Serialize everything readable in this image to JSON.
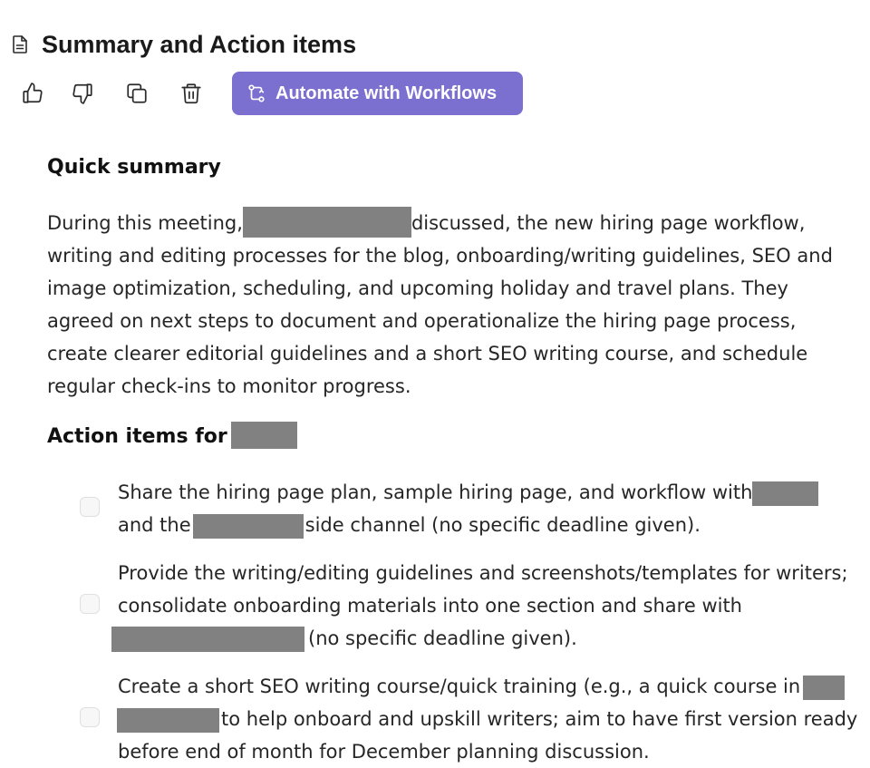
{
  "header": {
    "title": "Summary and Action items",
    "doc_icon": "document-icon"
  },
  "toolbar": {
    "like_icon": "thumbs-up-icon",
    "dislike_icon": "thumbs-down-icon",
    "copy_icon": "copy-icon",
    "delete_icon": "trash-icon",
    "workflow_label": "Automate with Workflows",
    "workflow_icon": "workflow-icon",
    "workflow_color": "#7b6fd0"
  },
  "summary": {
    "heading": "Quick summary",
    "text_before_redaction": "During this meeting,",
    "text_after_redaction": "discussed, the new hiring page workflow, writing and editing processes for the blog, onboarding/writing guidelines, SEO and image optimization, scheduling, and upcoming holiday and travel plans. They agreed on next steps to document and operationalize the hiring page process, create clearer editorial guidelines and a short SEO writing course, and schedule regular check-ins to monitor progress."
  },
  "action_items": {
    "heading": "Action items for",
    "items": [
      {
        "part1": "Share the hiring page plan, sample hiring page, and workflow with",
        "part2": "and the",
        "part3": "side channel (no specific deadline given).",
        "checked": false
      },
      {
        "part1": "Provide the writing/editing guidelines and screenshots/templates for writers; consolidate onboarding materials into one section and share with",
        "part2": "(no specific deadline given).",
        "checked": false
      },
      {
        "part1": "Create a short SEO writing course/quick training (e.g., a quick course in",
        "part2": "to help onboard and upskill writers; aim to have first version ready before end of month for December planning discussion.",
        "checked": false
      }
    ]
  }
}
